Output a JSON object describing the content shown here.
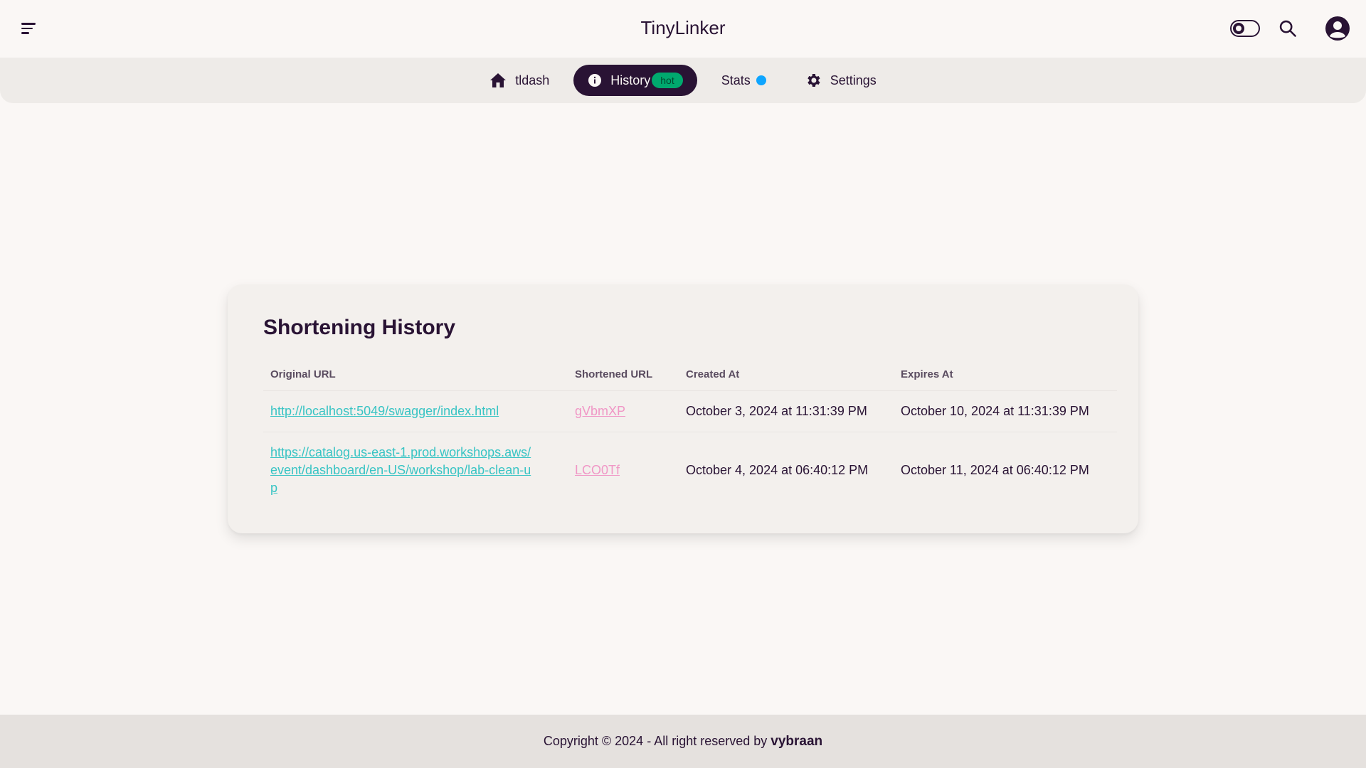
{
  "header": {
    "title": "TinyLinker",
    "menu_icon": "menu-icon",
    "theme_icon": "theme-toggle-icon",
    "search_icon": "search-icon",
    "avatar_icon": "user-circle-icon"
  },
  "nav": {
    "items": [
      {
        "label": "tldash",
        "icon": "home-icon"
      },
      {
        "label": "History",
        "icon": "info-icon",
        "badge": "hot"
      },
      {
        "label": "Stats",
        "indicator_color": "#0ea5ff"
      },
      {
        "label": "Settings",
        "icon": "gear-icon"
      }
    ],
    "active": "History"
  },
  "history": {
    "title": "Shortening History",
    "columns": [
      "Original URL",
      "Shortened URL",
      "Created At",
      "Expires At"
    ],
    "rows": [
      {
        "original": "http://localhost:5049/swagger/index.html",
        "shortened": "gVbmXP",
        "created": "October 3, 2024 at 11:31:39 PM",
        "expires": "October 10, 2024 at 11:31:39 PM"
      },
      {
        "original": "https://catalog.us-east-1.prod.workshops.aws/event/dashboard/en-US/workshop/lab-clean-up",
        "shortened": "LCO0Tf",
        "created": "October 4, 2024 at 06:40:12 PM",
        "expires": "October 11, 2024 at 06:40:12 PM"
      }
    ]
  },
  "footer": {
    "text": "Copyright © 2024 - All right reserved by",
    "owner": "vybraan"
  },
  "colors": {
    "primary": "#291334",
    "badge": "#00a96e",
    "link_original": "#38c4c4",
    "link_short": "#f097c6",
    "indicator": "#0ea5ff"
  }
}
